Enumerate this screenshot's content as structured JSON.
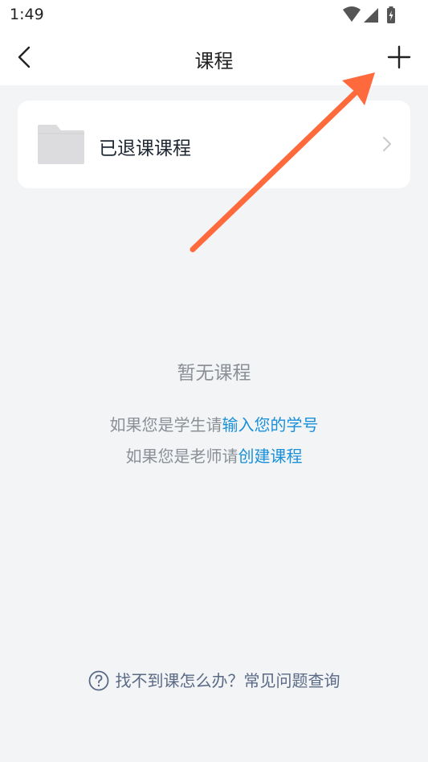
{
  "status_bar": {
    "time": "1:49",
    "icons": [
      "wifi-icon",
      "signal-icon",
      "battery-icon"
    ]
  },
  "nav": {
    "title": "课程",
    "back_icon": "back-arrow-icon",
    "add_icon": "plus-icon"
  },
  "card": {
    "label": "已退课课程",
    "icon": "folder-icon"
  },
  "empty": {
    "title": "暂无课程",
    "student_prefix": "如果您是学生请",
    "student_link": "输入您的学号",
    "teacher_prefix": "如果您是老师请",
    "teacher_link": "创建课程"
  },
  "help": {
    "text": "找不到课怎么办？常见问题查询",
    "icon": "question-circle-icon"
  },
  "colors": {
    "background": "#f3f4f6",
    "link": "#1a90d8",
    "annotation_arrow": "#ff6a3d"
  }
}
